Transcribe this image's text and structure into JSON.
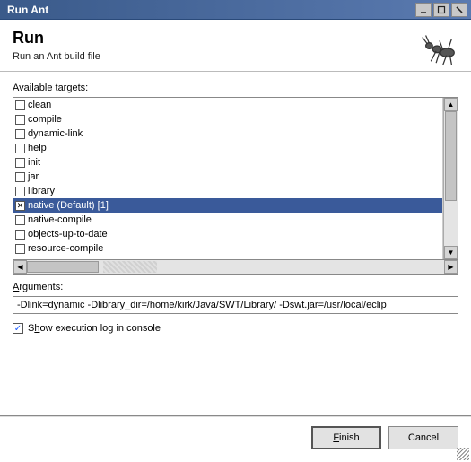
{
  "window": {
    "title": "Run Ant"
  },
  "header": {
    "title": "Run",
    "subtitle": "Run an Ant build file"
  },
  "targets_label": "Available targets:",
  "targets": [
    {
      "label": "clean",
      "checked": false,
      "selected": false
    },
    {
      "label": "compile",
      "checked": false,
      "selected": false
    },
    {
      "label": "dynamic-link",
      "checked": false,
      "selected": false
    },
    {
      "label": "help",
      "checked": false,
      "selected": false
    },
    {
      "label": "init",
      "checked": false,
      "selected": false
    },
    {
      "label": "jar",
      "checked": false,
      "selected": false
    },
    {
      "label": "library",
      "checked": false,
      "selected": false
    },
    {
      "label": "native (Default) [1]",
      "checked": true,
      "selected": true
    },
    {
      "label": "native-compile",
      "checked": false,
      "selected": false
    },
    {
      "label": "objects-up-to-date",
      "checked": false,
      "selected": false
    },
    {
      "label": "resource-compile",
      "checked": false,
      "selected": false
    }
  ],
  "arguments_label": "Arguments:",
  "arguments_value": "-Dlink=dynamic -Dlibrary_dir=/home/kirk/Java/SWT/Library/ -Dswt.jar=/usr/local/eclip",
  "show_log": {
    "checked": true,
    "label": "Show execution log in console"
  },
  "buttons": {
    "finish": "Finish",
    "cancel": "Cancel"
  }
}
